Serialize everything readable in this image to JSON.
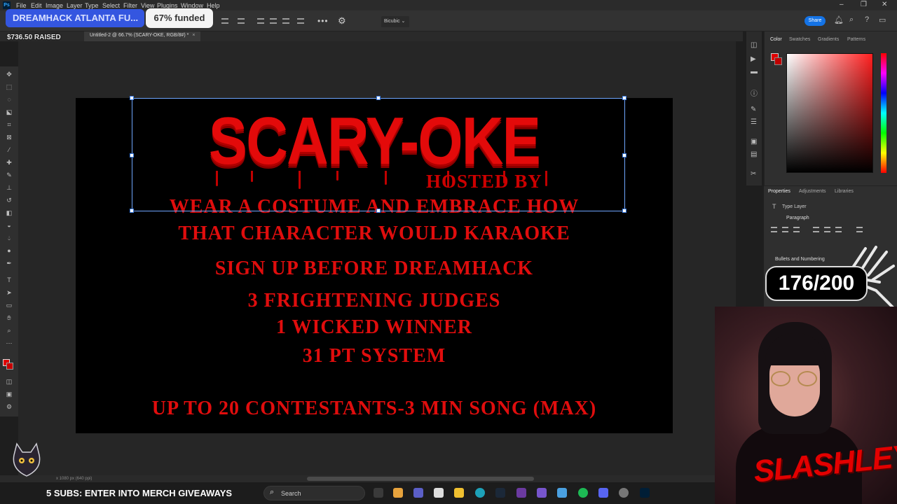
{
  "app": {
    "menu": [
      "File",
      "Edit",
      "Image",
      "Layer",
      "Type",
      "Select",
      "Filter",
      "View",
      "Plugins",
      "Window",
      "Help"
    ],
    "options": {
      "interpolation": "Bicubic",
      "share_label": "Share"
    },
    "document_tab": "Untitled-2 @ 66.7% (SCARY-OKE, RGB/8#) *",
    "status_text": "x 1080 px (640 ppi)"
  },
  "canvas": {
    "title": "SCARY-OKE",
    "hosted_by": "HOSTED BY",
    "lines": [
      "WEAR A COSTUME AND EMBRACE HOW",
      "THAT CHARACTER WOULD KARAOKE",
      "SIGN UP BEFORE DREAMHACK",
      "3 FRIGHTENING JUDGES",
      "1 WICKED WINNER",
      "31 PT  SYSTEM",
      "UP TO 20 CONTESTANTS-3 MIN SONG (MAX)"
    ],
    "text_color": "#e00d0d"
  },
  "panels": {
    "color_tabs": [
      "Color",
      "Swatches",
      "Gradients",
      "Patterns"
    ],
    "properties_tabs": [
      "Properties",
      "Adjustments",
      "Libraries"
    ],
    "type_layer": "Type Layer",
    "paragraph": "Paragraph",
    "bullets": "Bullets and Numbering"
  },
  "overlay": {
    "fund_title": "DREAMHACK ATLANTA FU...",
    "fund_percent": "67% funded",
    "raised": "$736.50 RAISED",
    "sub_counter": "176/200",
    "ticker": "5 SUBS: ENTER INTO MERCH GIVEAWAYS",
    "streamer_logo": "SLASHLEY"
  },
  "taskbar": {
    "search_placeholder": "Search"
  }
}
